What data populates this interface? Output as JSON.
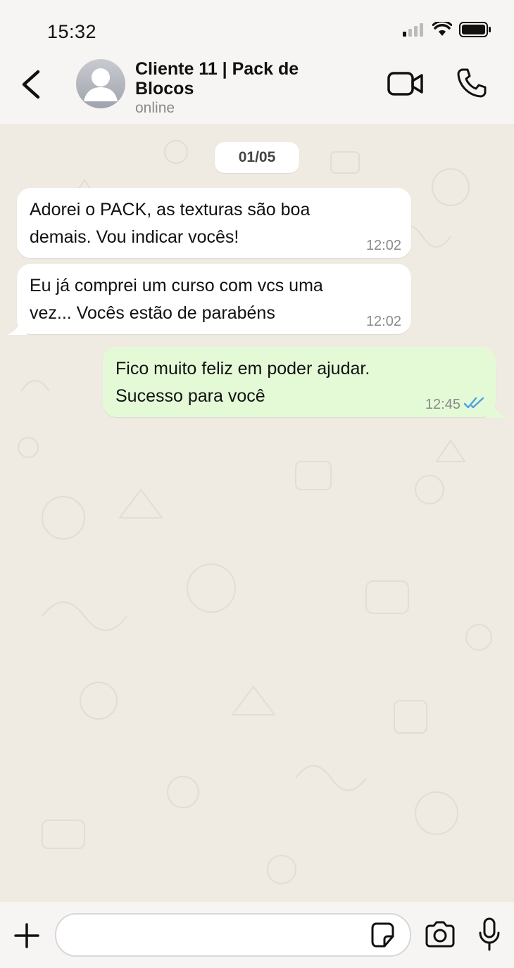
{
  "status_bar": {
    "time": "15:32",
    "icons": [
      "signal-icon",
      "wifi-icon",
      "battery-icon"
    ]
  },
  "header": {
    "contact_name": "Cliente 11 | Pack de Blocos",
    "contact_status": "online",
    "icons": [
      "back-icon",
      "avatar-icon",
      "video-call-icon",
      "phone-icon"
    ]
  },
  "chat": {
    "date": "01/05",
    "messages": [
      {
        "direction": "in",
        "line1": "Adorei o PACK, as texturas são boa",
        "line2": "demais. Vou indicar vocês!",
        "time": "12:02"
      },
      {
        "direction": "in",
        "line1": "Eu já comprei um curso com vcs uma",
        "line2": "vez... Vocês estão de parabéns",
        "time": "12:02"
      },
      {
        "direction": "out",
        "line1": "Fico muito feliz em poder ajudar.",
        "line2": "Sucesso para você",
        "time": "12:45",
        "read": true
      }
    ]
  },
  "input_bar": {
    "placeholder": "",
    "icons": [
      "plus-icon",
      "sticker-icon",
      "camera-icon",
      "mic-icon"
    ]
  },
  "colors": {
    "outgoing_bubble": "#e4fad7",
    "incoming_bubble": "#ffffff",
    "chat_background": "#efeae2",
    "read_ticks": "#4fa3e0"
  }
}
